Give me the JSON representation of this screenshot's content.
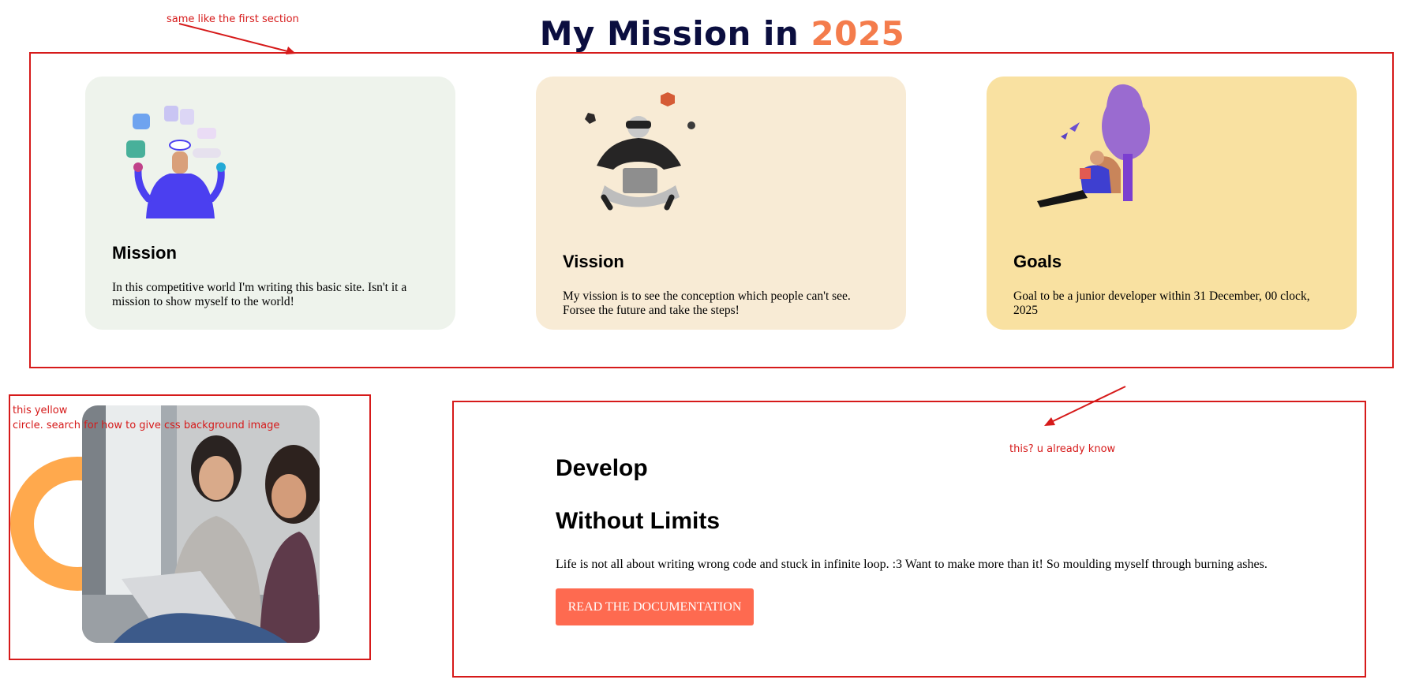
{
  "header": {
    "title_prefix": "My Mission in",
    "title_year": "2025"
  },
  "annotations": {
    "top_note": "same like the first section",
    "yellow_note_line1": "this yellow",
    "yellow_note_line2": "circle. search for how to give css background image",
    "button_note": "this? u already know"
  },
  "cards": [
    {
      "title": "Mission",
      "text": "In this competitive world I'm writing this basic site. Isn't it a mission to show myself to the world!",
      "bg": "#eef3ec",
      "illustration": "juggling-apps-person"
    },
    {
      "title": "Vission",
      "text": "My vission is to see the conception which people can't see. Forsee the future and take the steps!",
      "bg": "#f8ebd5",
      "illustration": "vr-laptop-person"
    },
    {
      "title": "Goals",
      "text": "Goal to be a junior developer within 31 December, 00 clock, 2025",
      "bg": "#f9e1a1",
      "illustration": "reading-under-tree"
    }
  ],
  "develop": {
    "heading1": "Develop",
    "heading2": "Without Limits",
    "text": "Life is not all about writing wrong code and stuck in infinite loop. :3 Want to make more than it! So moulding myself through burning ashes.",
    "button_label": "READ THE DOCUMENTATION"
  },
  "colors": {
    "accent": "#f47c4c",
    "title": "#0b0e3f",
    "button": "#fe6a50",
    "circle": "#ffa94d",
    "annotation": "#d61a1a"
  },
  "photo": {
    "subject": "two-women-with-laptop"
  }
}
